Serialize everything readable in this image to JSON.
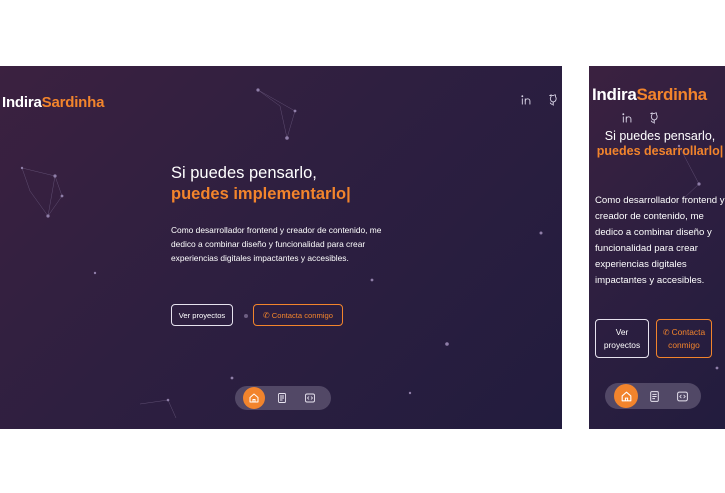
{
  "brand": {
    "first": "Indira",
    "second": "Sardinha"
  },
  "social": {
    "linkedin_icon": "linkedin-icon",
    "github_icon": "github-icon"
  },
  "hero": {
    "desktop_title": "Si puedes pensarlo,",
    "desktop_accent": "puedes implementarlo|",
    "mobile_title": "Si puedes pensarlo,",
    "mobile_accent": "puedes desarrollarlo|",
    "description": "Como desarrollador frontend y creador de contenido, me dedico a combinar diseño y funcionalidad para crear experiencias digitales impactantes y accesibles."
  },
  "buttons": {
    "projects": "Ver proyectos",
    "contact": "Contacta conmigo",
    "contact_icon": "whatsapp-icon"
  },
  "nav": {
    "items": [
      {
        "icon": "home-icon",
        "active": true
      },
      {
        "icon": "document-icon",
        "active": false
      },
      {
        "icon": "code-icon",
        "active": false
      }
    ]
  },
  "colors": {
    "accent": "#f2842c",
    "background_start": "#3b2140",
    "background_end": "#221c3e",
    "text": "#ffffff"
  }
}
